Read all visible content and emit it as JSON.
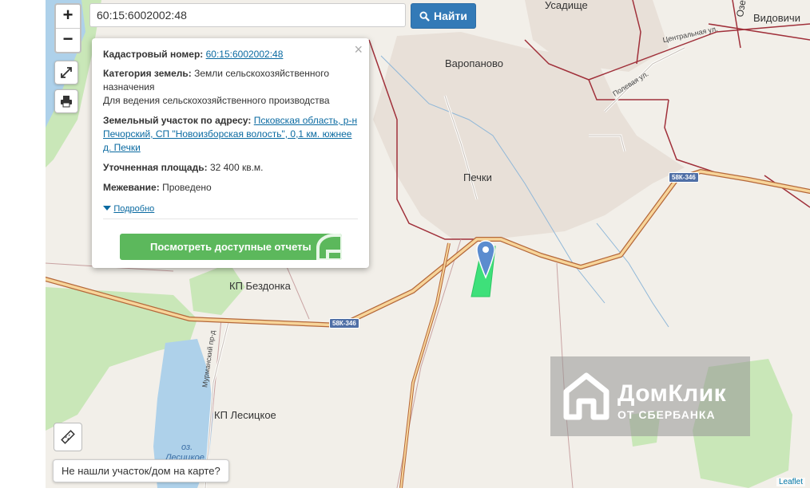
{
  "search": {
    "value": "60:15:6002002:48",
    "button_label": "Найти"
  },
  "zoom": {
    "in_label": "+",
    "out_label": "−"
  },
  "icons": {
    "search": "search-icon",
    "fullscreen": "expand-icon",
    "print": "printer-icon",
    "ruler": "ruler-icon",
    "close": "close-icon",
    "toggle": "caret-down-icon",
    "marker": "map-marker-icon"
  },
  "popup": {
    "close_label": "×",
    "cadastral_label": "Кадастровый номер:",
    "cadastral_value": "60:15:6002002:48",
    "category_label": "Категория земель:",
    "category_value": "Земли сельскохозяйственного назначения",
    "use_value": "Для ведения сельскохозяйственного производства",
    "address_label": "Земельный участок по адресу:",
    "address_value": "Псковская область, р-н Печорский, СП \"Новоизборская волость\", 0,1 км. южнее д. Печки",
    "area_label": "Уточненная площадь:",
    "area_value": "32 400 кв.м.",
    "survey_label": "Межевание:",
    "survey_value": "Проведено",
    "more_label": "Подробно",
    "reports_button": "Посмотреть доступные отчеты"
  },
  "map": {
    "places": {
      "usadishche": "Усадище",
      "vidovichi": "Видовичи",
      "oz": "Озе",
      "varopanovo": "Варопаново",
      "pechki": "Печки",
      "bezdonka": "КП Бездонка",
      "lesitskoe": "КП Лесицкое",
      "lake_prefix": "оз.",
      "lake_name": "Лесицкое"
    },
    "streets": {
      "central": "Центральная ул.",
      "field": "Полевая ул.",
      "murmansky": "Мурманский пр-д"
    },
    "road_shield": "58К-346"
  },
  "not_found_label": "Не нашли участок/дом на карте?",
  "watermark": {
    "title": "ДомКлик",
    "subtitle": "ОТ СБЕРБАНКА"
  },
  "attribution": "Leaflet",
  "colors": {
    "primary": "#337ab7",
    "success": "#5cb85c",
    "parcel": "#3ee07a",
    "boundary": "#a0303a",
    "road": "#f0c48a",
    "water": "#aed1ea",
    "forest": "#c9e7b8"
  }
}
